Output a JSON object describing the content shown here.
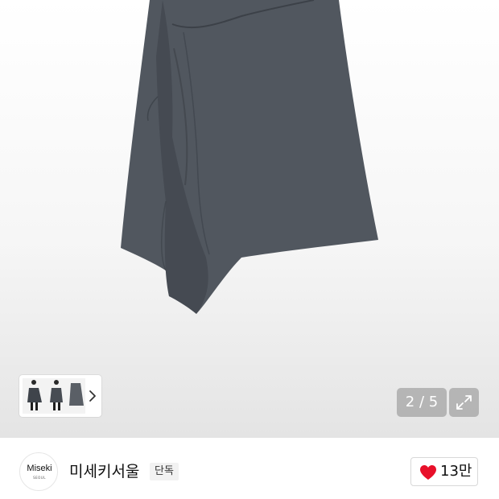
{
  "gallery": {
    "image_alt": "product-skirt-photo",
    "counter": "2 / 5",
    "thumbnail_icon": "chevron-right-icon",
    "expand_icon": "expand-icon"
  },
  "brand": {
    "logo_text": "Miseki",
    "logo_subtext": "SEOUL",
    "name": "미세키서울",
    "badge": "단독"
  },
  "like": {
    "count": "13만",
    "icon": "heart-icon",
    "color": "#e8102a"
  }
}
